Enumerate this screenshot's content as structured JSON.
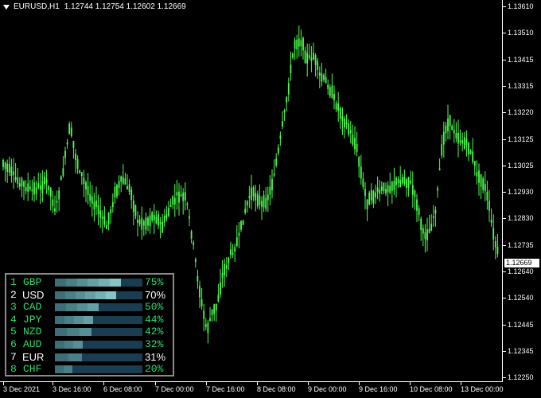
{
  "header": {
    "symbol": "EURUSD,H1",
    "ohlc": "1.12744 1.12754 1.12602 1.12669"
  },
  "colors": {
    "background": "#000000",
    "candle": "#4cff4c",
    "axis_text": "#ffffff",
    "strength_green": "#2fdc6e",
    "strength_white": "#ffffff",
    "bar_bg": "#1a3d52"
  },
  "price_axis": {
    "labels": [
      "1.13610",
      "1.13510",
      "1.13415",
      "1.13315",
      "1.13220",
      "1.13125",
      "1.13025",
      "1.12930",
      "1.12830",
      "1.12735",
      "1.12640",
      "1.12540",
      "1.12445",
      "1.12345",
      "1.12250"
    ],
    "current": "1.12669"
  },
  "time_axis": {
    "labels": [
      "3 Dec 2021",
      "3 Dec 16:00",
      "6 Dec 08:00",
      "7 Dec 00:00",
      "7 Dec 16:00",
      "8 Dec 08:00",
      "9 Dec 00:00",
      "9 Dec 16:00",
      "10 Dec 08:00",
      "13 Dec 00:00"
    ]
  },
  "currency_strength": [
    {
      "rank": "1",
      "name": "GBP",
      "pct": "75%",
      "value": 75,
      "highlight": false
    },
    {
      "rank": "2",
      "name": "USD",
      "pct": "70%",
      "value": 70,
      "highlight": true
    },
    {
      "rank": "3",
      "name": "CAD",
      "pct": "50%",
      "value": 50,
      "highlight": false
    },
    {
      "rank": "4",
      "name": "JPY",
      "pct": "44%",
      "value": 44,
      "highlight": false
    },
    {
      "rank": "5",
      "name": "NZD",
      "pct": "42%",
      "value": 42,
      "highlight": false
    },
    {
      "rank": "6",
      "name": "AUD",
      "pct": "32%",
      "value": 32,
      "highlight": false
    },
    {
      "rank": "7",
      "name": "EUR",
      "pct": "31%",
      "value": 31,
      "highlight": true
    },
    {
      "rank": "8",
      "name": "CHF",
      "pct": "20%",
      "value": 20,
      "highlight": false
    }
  ]
}
